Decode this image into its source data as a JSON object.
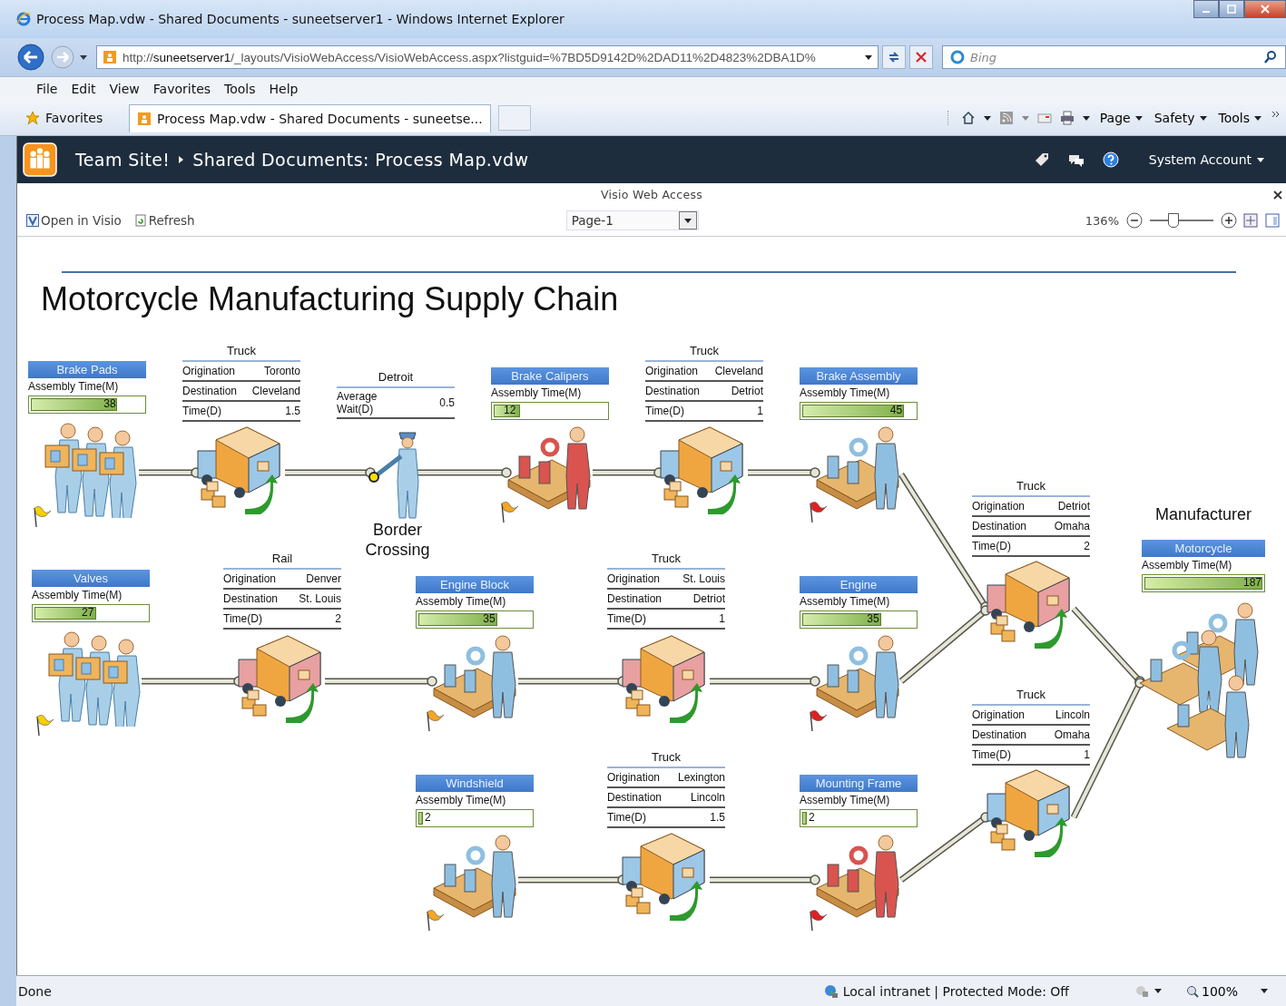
{
  "window": {
    "title": "Process Map.vdw - Shared Documents - suneetserver1 - Windows Internet Explorer"
  },
  "address_bar": {
    "url": "http://**suneetserver1**/_layouts/VisioWebAccess/VisioWebAccess.aspx?listguid=%7BD5D9142D%2DAD11%2D4823%2DBA1D%"
  },
  "search": {
    "placeholder": "Bing"
  },
  "menu": [
    "File",
    "Edit",
    "View",
    "Favorites",
    "Tools",
    "Help"
  ],
  "favorites_bar": {
    "label": "Favorites",
    "tabs": [
      {
        "label": "Process Map.vdw - Shared Documents - suneetse...",
        "selected": true
      }
    ],
    "commands": [
      "Page",
      "Safety",
      "Tools"
    ]
  },
  "site_bar": {
    "breadcrumb": [
      "Team Site!",
      "Shared Documents: Process Map.vdw"
    ],
    "user": "System Account"
  },
  "viewer": {
    "title": "Visio Web Access",
    "open_button": "Open in Visio",
    "refresh_button": "Refresh",
    "page": "Page-1",
    "zoom": "136%",
    "zoom_slider": {
      "level": 0.36
    }
  },
  "diagram": {
    "title": "Motorcycle Manufacturing Supply Chain",
    "manufacturer_label": "Manufacturer",
    "assemblies": [
      {
        "name": "Brake Pads",
        "metric": "Assembly Time(M)",
        "value": "38",
        "level": 0.77,
        "kind": "supplier",
        "flag": {
          "color": "#f5d000"
        }
      },
      {
        "name": "Brake Calipers",
        "metric": "Assembly Time(M)",
        "value": "12",
        "level": 0.23,
        "kind": "assembly",
        "color": "#d9544f",
        "flag": {
          "color": "#f5a623"
        }
      },
      {
        "name": "Brake Assembly",
        "metric": "Assembly Time(M)",
        "value": "45",
        "level": 0.9,
        "kind": "assembly",
        "color": "#8fbfe0",
        "flag": {
          "color": "#e02020"
        }
      },
      {
        "name": "Valves",
        "metric": "Assembly Time(M)",
        "value": "27",
        "level": 0.55,
        "kind": "supplier",
        "flag": {
          "color": "#f5d000"
        }
      },
      {
        "name": "Engine Block",
        "metric": "Assembly Time(M)",
        "value": "35",
        "level": 0.7,
        "kind": "assembly",
        "color": "#8fbfe0",
        "flag": {
          "color": "#f5a623"
        }
      },
      {
        "name": "Engine",
        "metric": "Assembly Time(M)",
        "value": "35",
        "level": 0.7,
        "kind": "assembly",
        "color": "#8fbfe0",
        "flag": {
          "color": "#e02020"
        }
      },
      {
        "name": "Windshield",
        "metric": "Assembly Time(M)",
        "value": "2",
        "level": 0.04,
        "kind": "assembly",
        "color": "#8fbfe0",
        "flag": {
          "color": "#f5a623"
        }
      },
      {
        "name": "Mounting Frame",
        "metric": "Assembly Time(M)",
        "value": "2",
        "level": 0.04,
        "kind": "assembly",
        "color": "#d9544f",
        "flag": {
          "color": "#e02020"
        }
      },
      {
        "name": "Motorcycle",
        "metric": "Assembly Time(M)",
        "value": "187",
        "level": 1,
        "kind": "manufacturer",
        "color": "#8fbfe0"
      }
    ],
    "transports": [
      {
        "mode": "Truck",
        "color": "#9cc7e6",
        "rows": [
          {
            "label": "Origination",
            "value": "Toronto"
          },
          {
            "label": "Destination",
            "value": "Cleveland"
          },
          {
            "label": "Time(D)",
            "value": "1.5"
          }
        ]
      },
      {
        "mode": "Truck",
        "color": "#9cc7e6",
        "rows": [
          {
            "label": "Origination",
            "value": "Cleveland"
          },
          {
            "label": "Destination",
            "value": "Detriot"
          },
          {
            "label": "Time(D)",
            "value": "1"
          }
        ]
      },
      {
        "mode": "Rail",
        "color": "#e8a0a0",
        "rows": [
          {
            "label": "Origination",
            "value": "Denver"
          },
          {
            "label": "Destination",
            "value": "St. Louis"
          },
          {
            "label": "Time(D)",
            "value": "2"
          }
        ]
      },
      {
        "mode": "Truck",
        "color": "#e8a0a0",
        "rows": [
          {
            "label": "Origination",
            "value": "St. Louis"
          },
          {
            "label": "Destination",
            "value": "Detriot"
          },
          {
            "label": "Time(D)",
            "value": "1"
          }
        ]
      },
      {
        "mode": "Truck",
        "color": "#9cc7e6",
        "rows": [
          {
            "label": "Origination",
            "value": "Lexington"
          },
          {
            "label": "Destination",
            "value": "Lincoln"
          },
          {
            "label": "Time(D)",
            "value": "1.5"
          }
        ]
      },
      {
        "mode": "Truck",
        "color": "#e8a0a0",
        "rows": [
          {
            "label": "Origination",
            "value": "Detriot"
          },
          {
            "label": "Destination",
            "value": "Omaha"
          },
          {
            "label": "Time(D)",
            "value": "2"
          }
        ]
      },
      {
        "mode": "Truck",
        "color": "#9cc7e6",
        "rows": [
          {
            "label": "Origination",
            "value": "Lincoln"
          },
          {
            "label": "Destination",
            "value": "Omaha"
          },
          {
            "label": "Time(D)",
            "value": "1"
          }
        ]
      }
    ],
    "border": {
      "title": "Detroit",
      "metric": "Average Wait(D)",
      "value": "0.5",
      "label": "Border Crossing"
    }
  },
  "status_bar": {
    "text": "Done",
    "zone": "Local intranet | Protected Mode: Off",
    "zoom": "100%"
  }
}
